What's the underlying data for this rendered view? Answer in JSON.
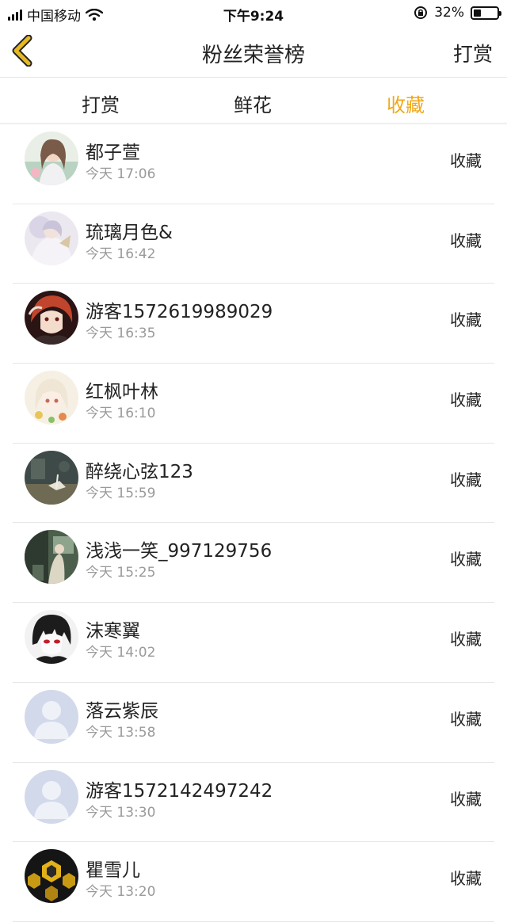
{
  "status_bar": {
    "carrier": "中国移动",
    "time": "下午9:24",
    "battery_percent": "32%",
    "battery_level": 0.32
  },
  "nav": {
    "title": "粉丝荣誉榜",
    "right_action": "打赏"
  },
  "tabs": [
    {
      "label": "打赏",
      "active": false
    },
    {
      "label": "鲜花",
      "active": false
    },
    {
      "label": "收藏",
      "active": true
    }
  ],
  "colors": {
    "accent": "#f0a818",
    "back_arrow": "#e8b820"
  },
  "rows": [
    {
      "name": "都子萱",
      "time": "今天 17:06",
      "action": "收藏",
      "avatar": "photo-girl-avatar"
    },
    {
      "name": "琉璃月色&",
      "time": "今天 16:42",
      "action": "收藏",
      "avatar": "anime-light-avatar"
    },
    {
      "name": "游客1572619989029",
      "time": "今天 16:35",
      "action": "收藏",
      "avatar": "anime-redhair-avatar"
    },
    {
      "name": "红枫叶林",
      "time": "今天 16:10",
      "action": "收藏",
      "avatar": "anime-flower-avatar"
    },
    {
      "name": "醉绕心弦123",
      "time": "今天 15:59",
      "action": "收藏",
      "avatar": "scene-dark-avatar"
    },
    {
      "name": "浅浅一笑_997129756",
      "time": "今天 15:25",
      "action": "收藏",
      "avatar": "scene-green-avatar"
    },
    {
      "name": "沫寒翼",
      "time": "今天 14:02",
      "action": "收藏",
      "avatar": "anime-bw-avatar"
    },
    {
      "name": "落云紫辰",
      "time": "今天 13:58",
      "action": "收藏",
      "avatar": "default-avatar"
    },
    {
      "name": "游客1572142497242",
      "time": "今天 13:30",
      "action": "收藏",
      "avatar": "default-avatar"
    },
    {
      "name": "瞿雪儿",
      "time": "今天 13:20",
      "action": "收藏",
      "avatar": "honeycomb-avatar"
    }
  ]
}
